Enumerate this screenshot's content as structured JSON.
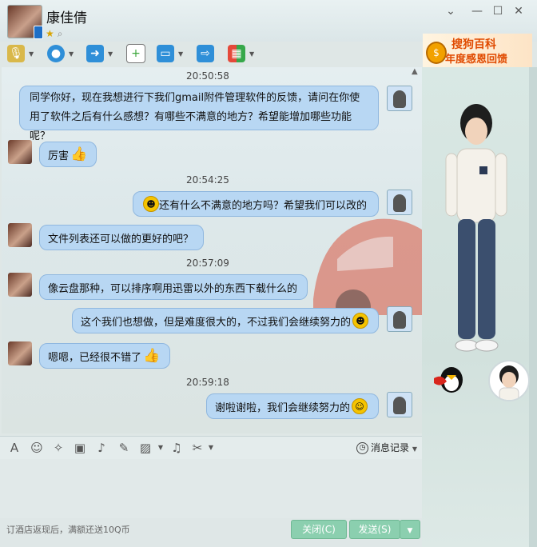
{
  "window": {
    "contact_name": "康佳倩",
    "controls": [
      "minimize-menu",
      "minimize",
      "maximize",
      "close"
    ]
  },
  "toolbar": {
    "items": [
      "voice-call",
      "video-call",
      "file-transfer",
      "send-sms",
      "remote-desktop",
      "share-screen",
      "apps"
    ]
  },
  "ad": {
    "line1": "搜狗百科",
    "line2": "年度感恩回馈"
  },
  "messages": [
    {
      "time": "20:50:58"
    },
    {
      "from": "me",
      "text": "同学你好，现在我想进行下我们gmail附件管理软件的反馈，请问在你使用了软件之后有什么感想？有哪些不满意的地方？希望能增加哪些功能呢？"
    },
    {
      "from": "friend",
      "text": "厉害"
    },
    {
      "time": "20:54:25"
    },
    {
      "from": "me",
      "text": "还有什么不满意的地方吗？希望我们可以改的"
    },
    {
      "from": "friend",
      "text": "文件列表还可以做的更好的吧？"
    },
    {
      "time": "20:57:09"
    },
    {
      "from": "friend",
      "text": "像云盘那种，可以排序啊用迅雷以外的东西下载什么的"
    },
    {
      "from": "me",
      "text": "这个我们也想做，但是难度很大的，不过我们会继续努力的"
    },
    {
      "from": "friend",
      "text": "嗯嗯，已经很不错了"
    },
    {
      "time": "20:59:18"
    },
    {
      "from": "me",
      "text": "谢啦谢啦，我们会继续努力的"
    }
  ],
  "input_toolbar": {
    "history_label": "消息记录"
  },
  "bottom": {
    "promo": "订酒店返现后，满额还送10Q币",
    "close_label": "关闭(C)",
    "send_label": "发送(S)"
  },
  "colors": {
    "bubble": "#b8d7f3",
    "button": "#8bcfaf",
    "ad_text": "#e04a00"
  }
}
